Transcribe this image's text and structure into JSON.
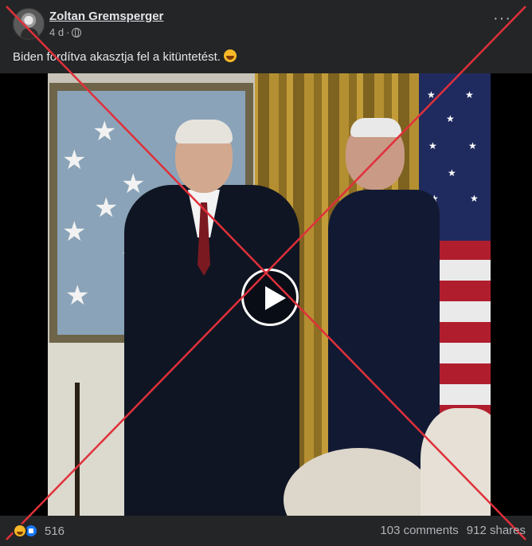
{
  "post": {
    "author": "Zoltan Gremsperger",
    "time": "4 d",
    "separator": "·",
    "privacy_icon": "globe-icon",
    "menu_icon": "more-icon",
    "caption": "Biden fordítva akasztja fel a kitüntetést.",
    "caption_emoji": "laughing-face-icon"
  },
  "video": {
    "play_icon": "play-icon",
    "overlay": "red-x-cross"
  },
  "footer": {
    "reaction_icons": [
      "haha-icon",
      "like-icon"
    ],
    "reaction_count": "516",
    "comments": "103 comments",
    "shares": "912 shares"
  },
  "colors": {
    "background": "#242526",
    "text": "#e4e6eb",
    "secondary_text": "#b0b3b8",
    "cross": "#e0303a",
    "like_blue": "#1877f2",
    "haha_yellow": "#f7b928"
  }
}
